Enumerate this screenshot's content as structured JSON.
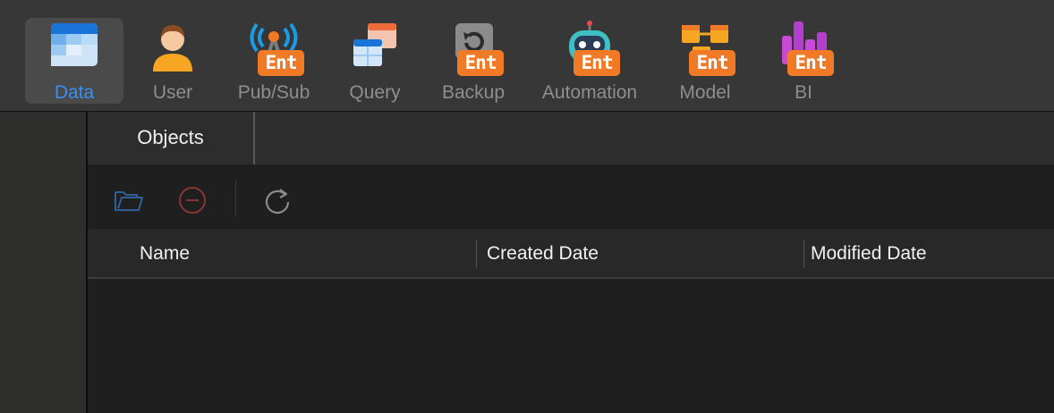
{
  "toolbar": {
    "tools": [
      {
        "label": "Data",
        "icon": "data-grid-icon",
        "active": true
      },
      {
        "label": "User",
        "icon": "user-icon"
      },
      {
        "label": "Pub/Sub",
        "icon": "broadcast-antenna-icon",
        "badge": "Ent"
      },
      {
        "label": "Query",
        "icon": "query-tables-icon"
      },
      {
        "label": "Backup",
        "icon": "backup-restore-icon",
        "badge": "Ent"
      },
      {
        "label": "Automation",
        "icon": "robot-icon",
        "badge": "Ent"
      },
      {
        "label": "Model",
        "icon": "model-diagram-icon",
        "badge": "Ent"
      },
      {
        "label": "BI",
        "icon": "bar-chart-icon",
        "badge": "Ent"
      }
    ]
  },
  "tabs": [
    {
      "label": "Objects"
    }
  ],
  "actions": [
    {
      "name": "open-folder-icon"
    },
    {
      "name": "remove-circle-icon"
    },
    {
      "name": "refresh-icon"
    }
  ],
  "table": {
    "columns": [
      "Name",
      "Created Date",
      "Modified Date"
    ],
    "rows": []
  },
  "colors": {
    "active_label": "#3a8ef0",
    "ent_badge": "#f07a26",
    "toolbar_bg": "#373737",
    "content_bg": "#1f1f1f"
  }
}
